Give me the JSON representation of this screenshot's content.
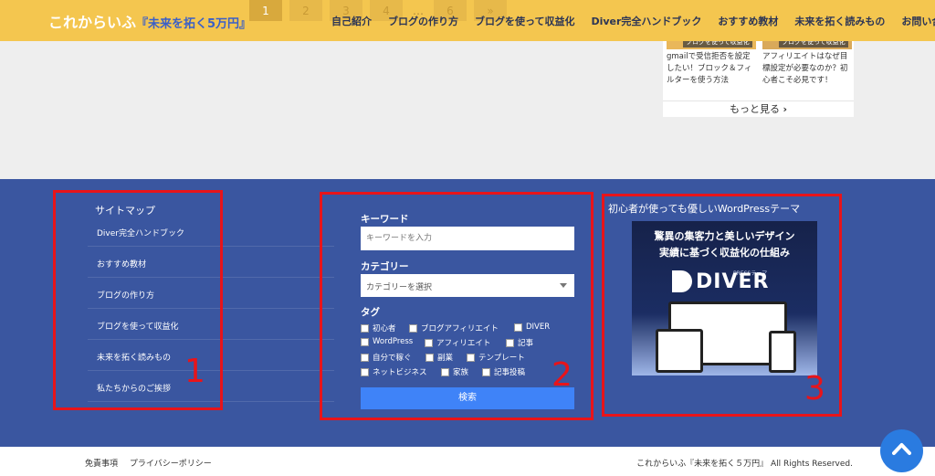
{
  "header": {
    "logo": "これからいふ",
    "logo_sub": "『未来を拓く5万円』",
    "nav": [
      "自己紹介",
      "ブログの作り方",
      "ブログを使って収益化",
      "Diver完全ハンドブック",
      "おすすめ教材",
      "未来を拓く読みもの",
      "お問い合わせ"
    ]
  },
  "pager": {
    "pages": [
      "1",
      "2",
      "3",
      "4",
      "…",
      "6",
      "»"
    ],
    "active": "1"
  },
  "cards": [
    {
      "category": "ブログを使って収益化",
      "caption": "gmailで受信拒否を設定したい！ブロック＆フィルターを使う方法"
    },
    {
      "category": "ブログを使って収益化",
      "caption": "アフィリエイトはなぜ目標設定が必要なのか？初心者こそ必見です！"
    }
  ],
  "more_label": "もっと見る",
  "sitemap": {
    "title": "サイトマップ",
    "items": [
      "Diver完全ハンドブック",
      "おすすめ教材",
      "ブログの作り方",
      "ブログを使って収益化",
      "未来を拓く読みもの",
      "私たちからのご挨拶"
    ]
  },
  "search": {
    "keyword_label": "キーワード",
    "keyword_placeholder": "キーワードを入力",
    "category_label": "カテゴリー",
    "category_selected": "カテゴリーを選択",
    "tag_label": "タグ",
    "tags": [
      "初心者",
      "ブログアフィリエイト",
      "DIVER",
      "WordPress",
      "アフィリエイト",
      "記事",
      "自分で稼ぐ",
      "副業",
      "テンプレート",
      "ネットビジネス",
      "家族",
      "記事投稿"
    ],
    "button_label": "検索"
  },
  "ad": {
    "title": "初心者が使っても優しいWordPressテーマ",
    "line1": "驚異の集客力と美しいデザイン",
    "line2": "実績に基づく収益化の仕組み",
    "brand_top": "PRESSテーマ",
    "brand": "DIVER"
  },
  "annotations": [
    "1",
    "2",
    "3"
  ],
  "footer": {
    "links": [
      "免責事項",
      "プライバシーポリシー"
    ],
    "copyright": "これからいふ『未来を拓く５万円』 All Rights Reserved."
  },
  "colors": {
    "header": "#f4c64f",
    "widgets": "#3a56a0",
    "accent": "#3f83f8",
    "annotation": "#e8141a"
  }
}
